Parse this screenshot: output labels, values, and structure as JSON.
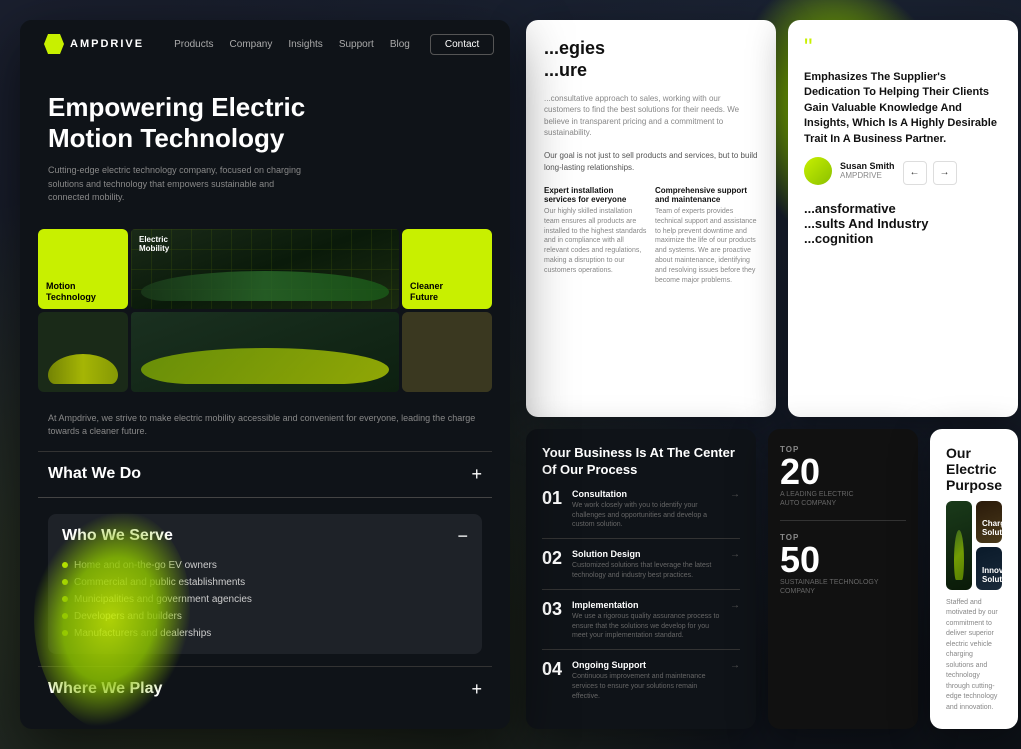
{
  "page": {
    "background": "#1a1f2e"
  },
  "navbar": {
    "logo_text": "AMPDRIVE",
    "links": [
      "Products",
      "Company",
      "Insights",
      "Support",
      "Blog"
    ],
    "cta_label": "Contact"
  },
  "hero": {
    "title": "Empowering Electric\nMotion Technology",
    "subtitle": "Cutting-edge electric technology company, focused on charging solutions and technology that empowers sustainable and connected mobility."
  },
  "grid": {
    "cells": [
      {
        "label": "Motion\nTechnology",
        "type": "lime"
      },
      {
        "label": "Electric\nMobility",
        "type": "dark"
      },
      {
        "label": "Cleaner\nFuture",
        "type": "lime"
      }
    ]
  },
  "mission": {
    "text": "At Ampdrive, we strive to make electric mobility accessible and convenient for everyone, leading the charge towards a cleaner future."
  },
  "accordion": {
    "items": [
      {
        "title": "What We Do",
        "icon": "+",
        "open": false
      },
      {
        "title": "Who We Serve",
        "icon": "−",
        "open": true,
        "list": [
          "Home and on-the-go EV owners",
          "Commercial and public establishments",
          "Municipalities and government agencies",
          "Developers and builders",
          "Manufacturers and dealerships"
        ]
      },
      {
        "title": "Where We Play",
        "icon": "+",
        "open": false
      }
    ]
  },
  "panel_strategies": {
    "title": "...egies\n...ure",
    "subtitle": "...consultative approach to sales, working with our customers to find the best solutions for their needs. We believe in transparent pricing and a commitment to sustainability.",
    "body": "Our goal is not just to sell products and services, but to build long-lasting relationships.",
    "services": [
      {
        "title": "Expert installation services for everyone",
        "desc": "Our highly skilled installation team ensures all products are installed to the highest standards and in compliance with all relevant codes and regulations, making a disruption to our customers operations."
      },
      {
        "title": "Comprehensive support and maintenance",
        "desc": "Team of experts provides technical support and assistance to help prevent downtime and maximize the life of our products and systems. We are proactive about maintenance, identifying and resolving issues before they become major problems."
      }
    ]
  },
  "panel_testimonial": {
    "quote": "Emphasizes The Supplier's Dedication To Helping Their Clients Gain Valuable Knowledge And Insights, Which Is A Highly Desirable Trait In A Business Partner.",
    "author_name": "Susan Smith",
    "author_role": "AMPDRIVE",
    "transformative_title": "...ansformative\n...sults And Industry\n...cognition"
  },
  "panel_process": {
    "title": "Your Business Is At The Center Of Our Process",
    "steps": [
      {
        "number": "01",
        "title": "Consultation",
        "desc": "We work closely with you to identify your challenges and opportunities and develop a custom solution."
      },
      {
        "number": "02",
        "title": "Solution Design",
        "desc": "Customized solutions that leverage the latest technology and industry best practices."
      },
      {
        "number": "03",
        "title": "Implementation",
        "desc": "We use a rigorous quality assurance process to ensure that the solutions we develop for you meet your implementation standard."
      },
      {
        "number": "04",
        "title": "Ongoing Support",
        "desc": "Continuous improvement and maintenance services to ensure your solutions remain effective."
      }
    ]
  },
  "panel_awards": {
    "items": [
      {
        "top_label": "TOP",
        "number": "20",
        "desc": "A LEADING ELECTRIC\nAUTO COMPANY"
      },
      {
        "top_label": "TOP",
        "number": "50",
        "desc": "SUSTAINABLE TECHNOLOGY\nCOMPANY"
      }
    ]
  },
  "panel_purpose": {
    "title": "Our Electric Purpose",
    "images": [
      {
        "label": "",
        "type": "car-large"
      },
      {
        "label": "Charging\nSolutions",
        "type": "charge"
      },
      {
        "label": "Innovative\nSolutions",
        "type": "interior"
      }
    ],
    "text": "Staffed and motivated by our commitment to deliver superior electric vehicle charging solutions and technology through cutting-edge technology and innovation."
  }
}
